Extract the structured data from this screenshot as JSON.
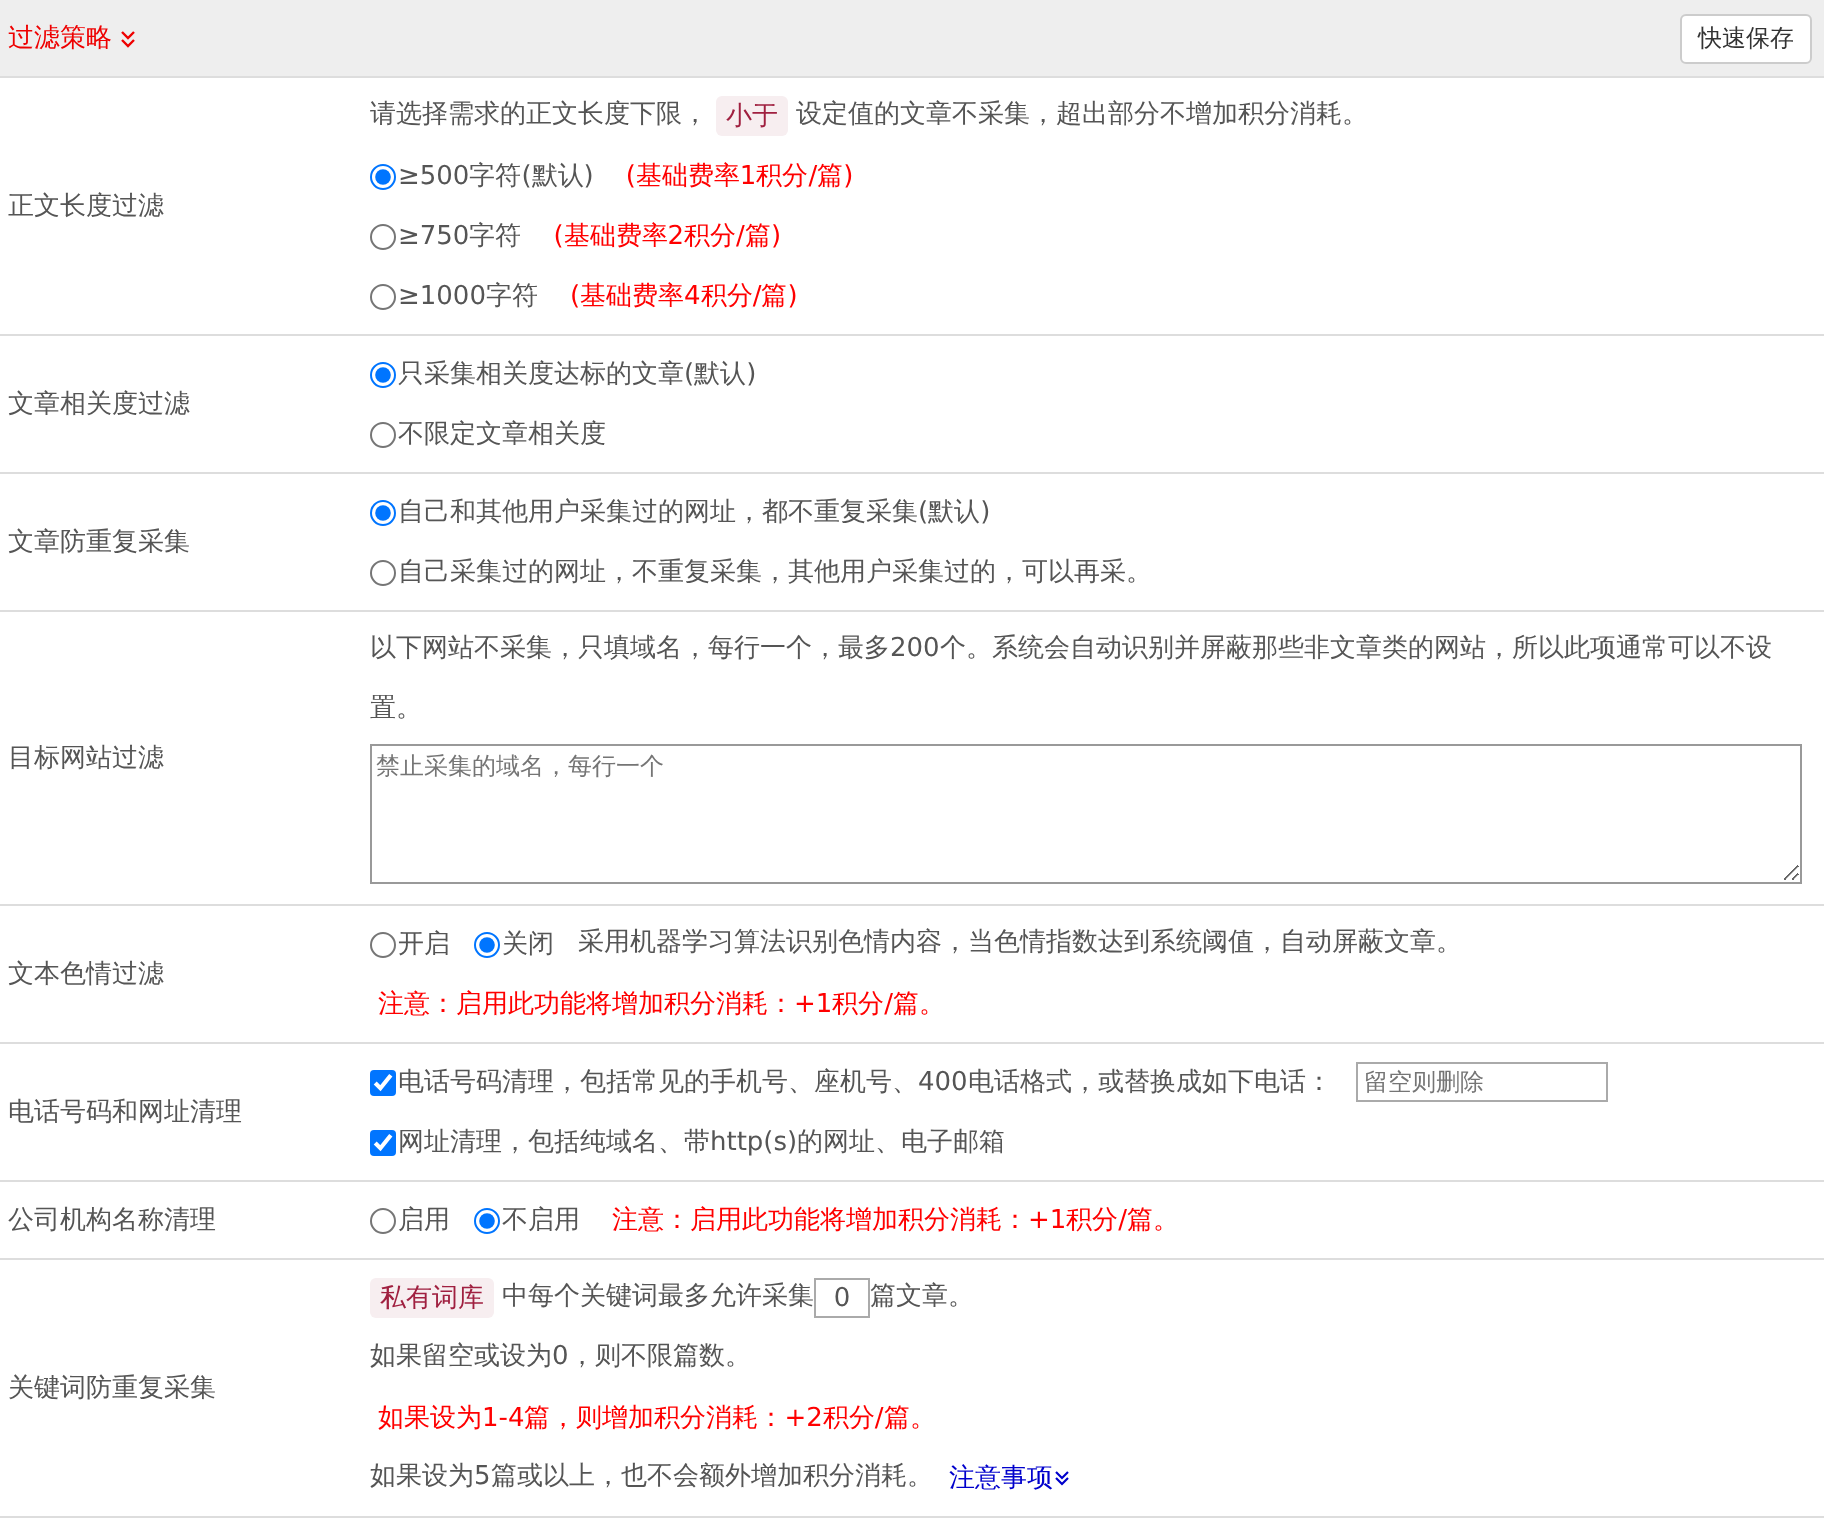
{
  "header": {
    "title": "过滤策略",
    "save_button": "快速保存"
  },
  "sections": [
    {
      "label": "正文长度过滤",
      "lines": [
        [
          {
            "kind": "text",
            "text": "请选择需求的正文长度下限，"
          },
          {
            "kind": "tag",
            "text": "小于"
          },
          {
            "kind": "text",
            "text": "设定值的文章不采集，超出部分不增加积分消耗。"
          }
        ],
        [
          {
            "kind": "radio",
            "text": "≥500字符(默认)",
            "selected": true
          },
          {
            "kind": "note",
            "text": "(基础费率1积分/篇)"
          }
        ],
        [
          {
            "kind": "radio",
            "text": "≥750字符",
            "selected": false
          },
          {
            "kind": "note",
            "text": "(基础费率2积分/篇)"
          }
        ],
        [
          {
            "kind": "radio",
            "text": "≥1000字符",
            "selected": false
          },
          {
            "kind": "note",
            "text": "(基础费率4积分/篇)"
          }
        ]
      ]
    },
    {
      "label": "文章相关度过滤",
      "lines": [
        [
          {
            "kind": "radio",
            "text": "只采集相关度达标的文章(默认)",
            "selected": true
          }
        ],
        [
          {
            "kind": "radio",
            "text": "不限定文章相关度",
            "selected": false
          }
        ]
      ]
    },
    {
      "label": "文章防重复采集",
      "lines": [
        [
          {
            "kind": "radio",
            "text": "自己和其他用户采集过的网址，都不重复采集(默认)",
            "selected": true
          }
        ],
        [
          {
            "kind": "radio",
            "text": "自己采集过的网址，不重复采集，其他用户采集过的，可以再采。",
            "selected": false
          }
        ]
      ]
    },
    {
      "label": "目标网站过滤",
      "lines": [
        [
          {
            "kind": "text",
            "text": "以下网站不采集，只填域名，每行一个，最多200个。系统会自动识别并屏蔽那些非文章类的网站，所以此项通常可以不设置。"
          }
        ],
        [
          {
            "kind": "textarea",
            "placeholder": "禁止采集的域名，每行一个"
          }
        ]
      ]
    },
    {
      "label": "文本色情过滤",
      "lines": [
        [
          {
            "kind": "radio",
            "text": "开启",
            "selected": false
          },
          {
            "kind": "radio",
            "text": "关闭",
            "selected": true
          },
          {
            "kind": "text",
            "text": "采用机器学习算法识别色情内容，当色情指数达到系统阈值，自动屏蔽文章。"
          }
        ],
        [
          {
            "kind": "note",
            "text": "注意：启用此功能将增加积分消耗：+1积分/篇。"
          }
        ]
      ]
    },
    {
      "label": "电话号码和网址清理",
      "lines": [
        [
          {
            "kind": "checkbox",
            "text": "电话号码清理，包括常见的手机号、座机号、400电话格式，或替换成如下电话：",
            "checked": true
          },
          {
            "kind": "input",
            "placeholder": "留空则删除"
          }
        ],
        [
          {
            "kind": "checkbox",
            "text": "网址清理，包括纯域名、带http(s)的网址、电子邮箱",
            "checked": true
          }
        ]
      ]
    },
    {
      "label": "公司机构名称清理",
      "lines": [
        [
          {
            "kind": "radio",
            "text": "启用",
            "selected": false
          },
          {
            "kind": "radio",
            "text": "不启用",
            "selected": true
          },
          {
            "kind": "note",
            "text": "注意：启用此功能将增加积分消耗：+1积分/篇。"
          }
        ]
      ]
    },
    {
      "label": "关键词防重复采集",
      "lines": [
        [
          {
            "kind": "tag",
            "text": "私有词库"
          },
          {
            "kind": "text",
            "text": "中每个关键词最多允许采集"
          },
          {
            "kind": "number",
            "value": "0"
          },
          {
            "kind": "text",
            "text": "篇文章。"
          }
        ],
        [
          {
            "kind": "text",
            "text": "如果留空或设为0，则不限篇数。"
          }
        ],
        [
          {
            "kind": "note",
            "text": "如果设为1-4篇，则增加积分消耗：+2积分/篇。"
          }
        ],
        [
          {
            "kind": "text",
            "text": "如果设为5篇或以上，也不会额外增加积分消耗。"
          },
          {
            "kind": "link",
            "text": "注意事项"
          }
        ]
      ]
    }
  ]
}
